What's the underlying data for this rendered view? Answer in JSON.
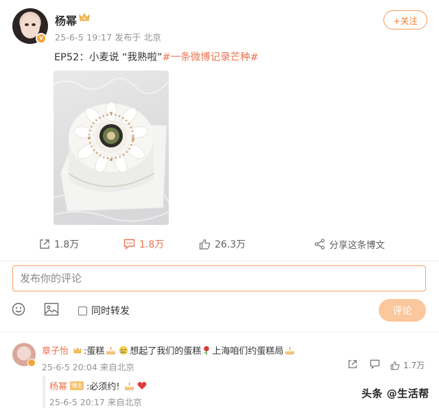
{
  "post": {
    "username": "杨幂",
    "meta": "25-6-5 19:17  发布于 北京",
    "follow_label": "+关注",
    "text_prefix": "EP52：小麦说 “我熟啦”",
    "text_tag": "#一条微博记录芒种#",
    "stats": {
      "repost": "1.8万",
      "comment": "1.8万",
      "like": "26.3万",
      "share": "分享这条博文"
    },
    "v_mark": "v"
  },
  "composer": {
    "placeholder": "发布你的评论",
    "repost_label": "同时转发",
    "submit_label": "评论"
  },
  "comment": {
    "username": "章子怡",
    "text_1": ":蛋糕",
    "text_2": "想起了我们的蛋糕",
    "text_3": "上海咱们约蛋糕局",
    "meta": "25-6-5 20:04 来自北京",
    "like_count": "1.7万"
  },
  "reply": {
    "username": "杨幂",
    "badge": "博主",
    "text": ":必须约!",
    "meta": "25-6-5 20:17 来自北京"
  },
  "watermark": "头条 @生活帮",
  "colors": {
    "accent": "#eb7350",
    "submit_disabled": "#fbc79c",
    "follow_border": "#f39a52"
  },
  "icons": [
    "crown-icon",
    "repost-icon",
    "comment-icon",
    "like-icon",
    "share-icon",
    "emoji-icon",
    "image-icon",
    "cake-emoji-icon",
    "crying-emoji-icon",
    "rose-emoji-icon",
    "heart-emoji-icon"
  ]
}
